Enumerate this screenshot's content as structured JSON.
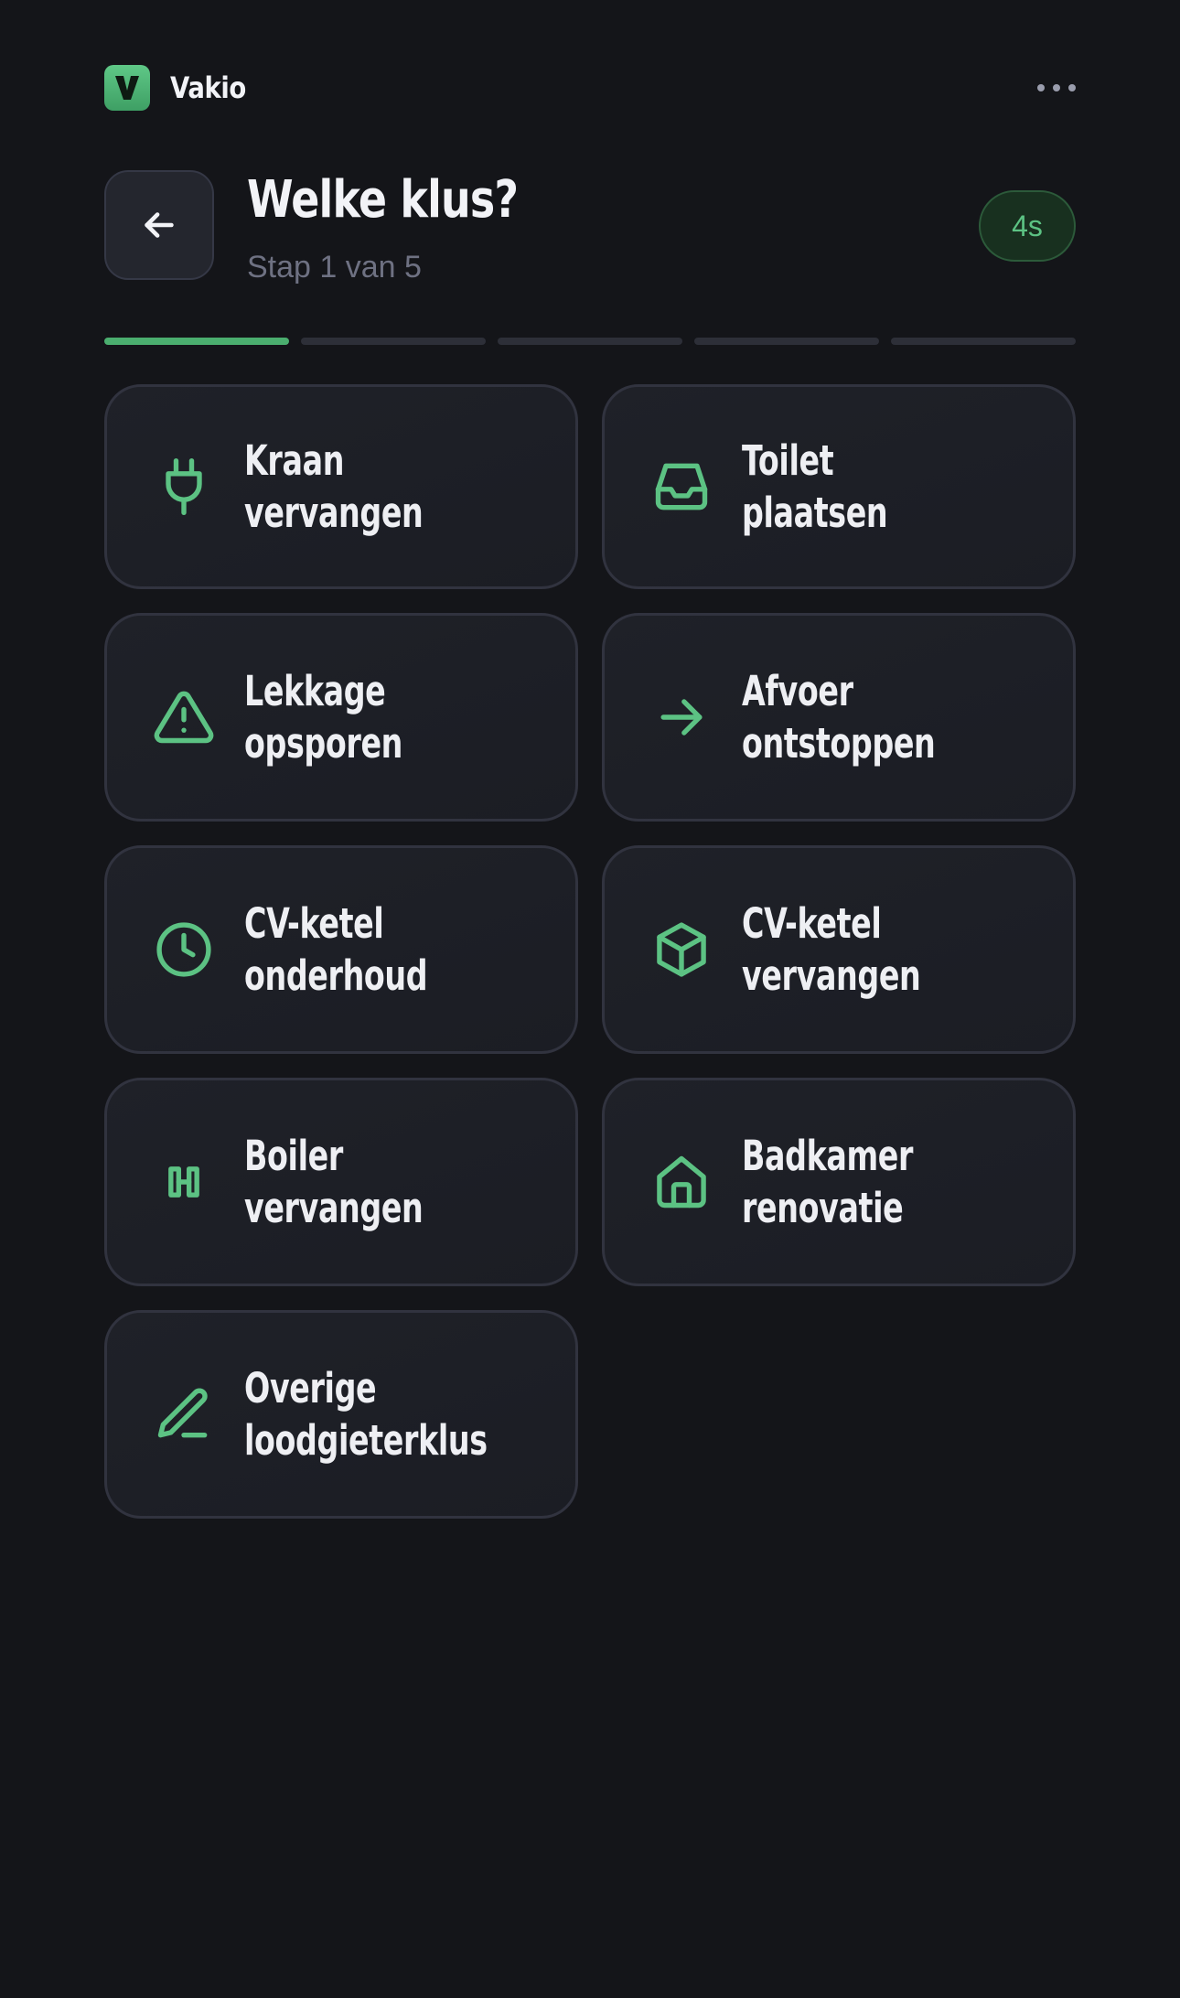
{
  "app": {
    "name": "Vakio",
    "logo_letter": "V",
    "accent_color": "#4BAE6F"
  },
  "header": {
    "title": "Welke klus?",
    "subtitle": "Stap 1 van 5",
    "timer": "4s"
  },
  "progress": {
    "total_steps": 5,
    "current_step": 1
  },
  "options": [
    {
      "label": "Kraan vervangen",
      "icon": "plug-icon"
    },
    {
      "label": "Toilet plaatsen",
      "icon": "inbox-icon"
    },
    {
      "label": "Lekkage opsporen",
      "icon": "warning-icon"
    },
    {
      "label": "Afvoer ontstoppen",
      "icon": "arrow-right-icon"
    },
    {
      "label": "CV-ketel onderhoud",
      "icon": "clock-icon"
    },
    {
      "label": "CV-ketel vervangen",
      "icon": "box-icon"
    },
    {
      "label": "Boiler vervangen",
      "icon": "boiler-icon"
    },
    {
      "label": "Badkamer renovatie",
      "icon": "home-icon"
    },
    {
      "label": "Overige loodgieterklus",
      "icon": "pen-icon"
    }
  ]
}
